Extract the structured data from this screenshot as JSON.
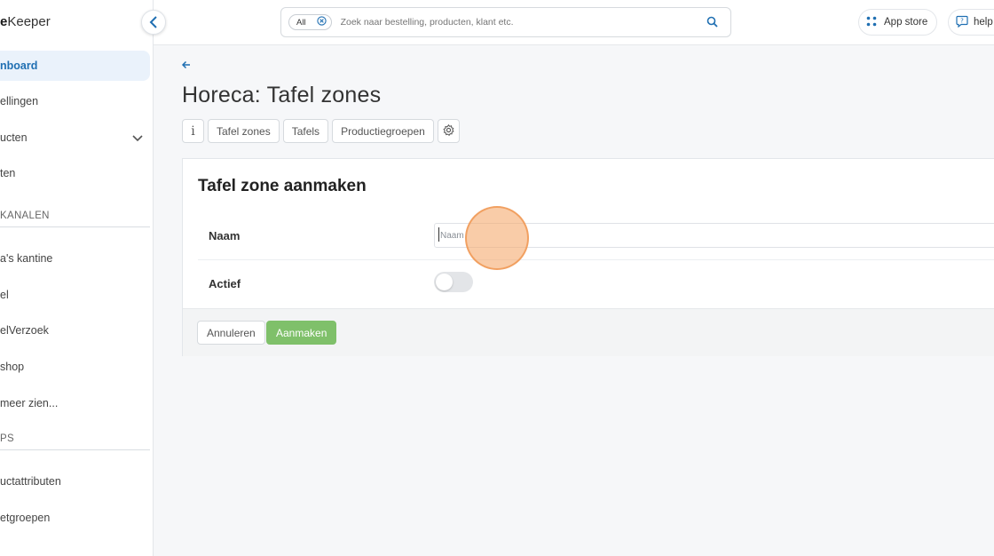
{
  "sidebar": {
    "logo_bold": "e",
    "logo_rest": "Keeper",
    "items": [
      {
        "label": "nboard"
      },
      {
        "label": "ellingen"
      },
      {
        "label": "ucten"
      },
      {
        "label": "ten"
      },
      {
        "label": "a's kantine"
      },
      {
        "label": "el"
      },
      {
        "label": "elVerzoek"
      },
      {
        "label": "shop"
      },
      {
        "label": "meer zien..."
      },
      {
        "label": "uctattributen"
      },
      {
        "label": "etgroepen"
      }
    ],
    "sections": [
      "KANALEN",
      "PS"
    ]
  },
  "topbar": {
    "search_filter": "All",
    "search_placeholder": "Zoek naar bestelling, producten, klant etc.",
    "app_store_label": "App store",
    "help_label": "help"
  },
  "page": {
    "title": "Horeca: Tafel zones",
    "tabs": [
      "Tafel zones",
      "Tafels",
      "Productiegroepen"
    ],
    "info_tab": "i"
  },
  "form": {
    "title": "Tafel zone aanmaken",
    "name_label": "Naam",
    "name_placeholder": "Naam",
    "name_value": "",
    "active_label": "Actief",
    "active_value": false,
    "cancel_label": "Annuleren",
    "create_label": "Aanmaken"
  },
  "colors": {
    "accent": "#1f6fb2",
    "primary_button": "#7fc06a",
    "click_marker": "#f5aa6e"
  }
}
